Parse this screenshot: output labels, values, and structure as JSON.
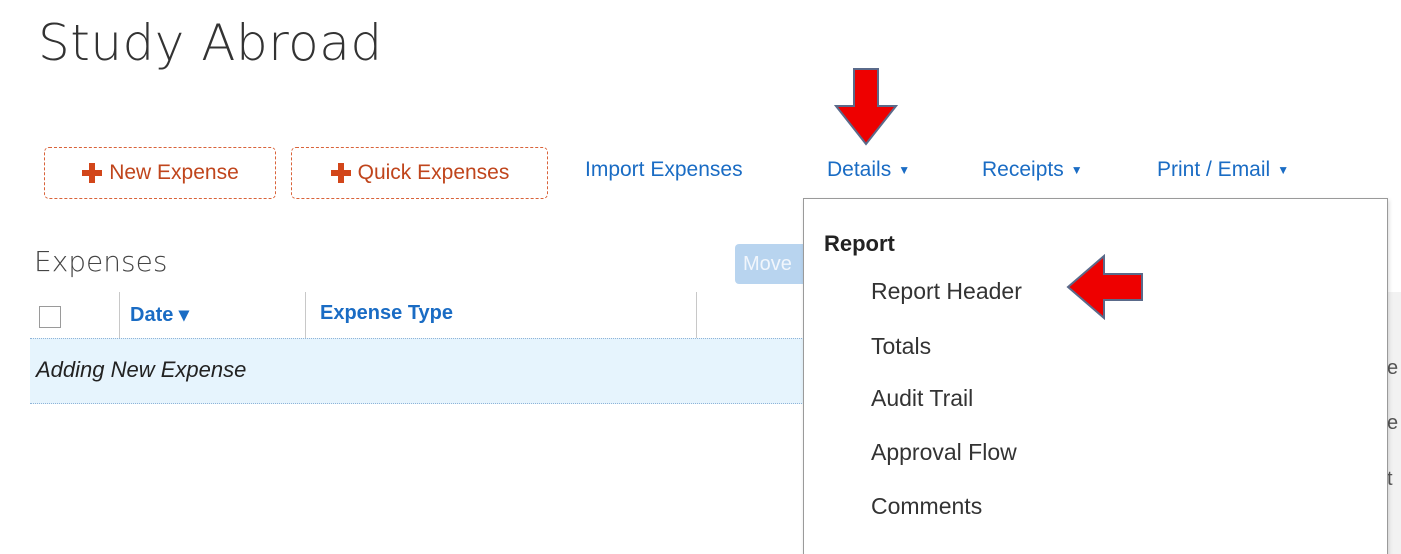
{
  "report": {
    "title": "Study Abroad"
  },
  "toolbar": {
    "new_expense_label": "New Expense",
    "quick_expenses_label": "Quick Expenses",
    "import_expenses_label": "Import Expenses",
    "details_label": "Details",
    "receipts_label": "Receipts",
    "print_email_label": "Print / Email",
    "caret_glyph": "▼"
  },
  "expenses": {
    "heading": "Expenses",
    "move_label": "Move",
    "columns": [
      "Date ▾",
      "Expense Type"
    ],
    "adding_row_text": "Adding New Expense"
  },
  "details_menu": {
    "section_label": "Report",
    "items": [
      "Report Header",
      "Totals",
      "Audit Trail",
      "Approval Flow",
      "Comments"
    ]
  },
  "right_fragments": [
    "e",
    "e",
    "t"
  ],
  "colors": {
    "link_blue": "#1a6cc4",
    "accent_orange": "#d9633a",
    "arrow_red": "#ee0000"
  }
}
